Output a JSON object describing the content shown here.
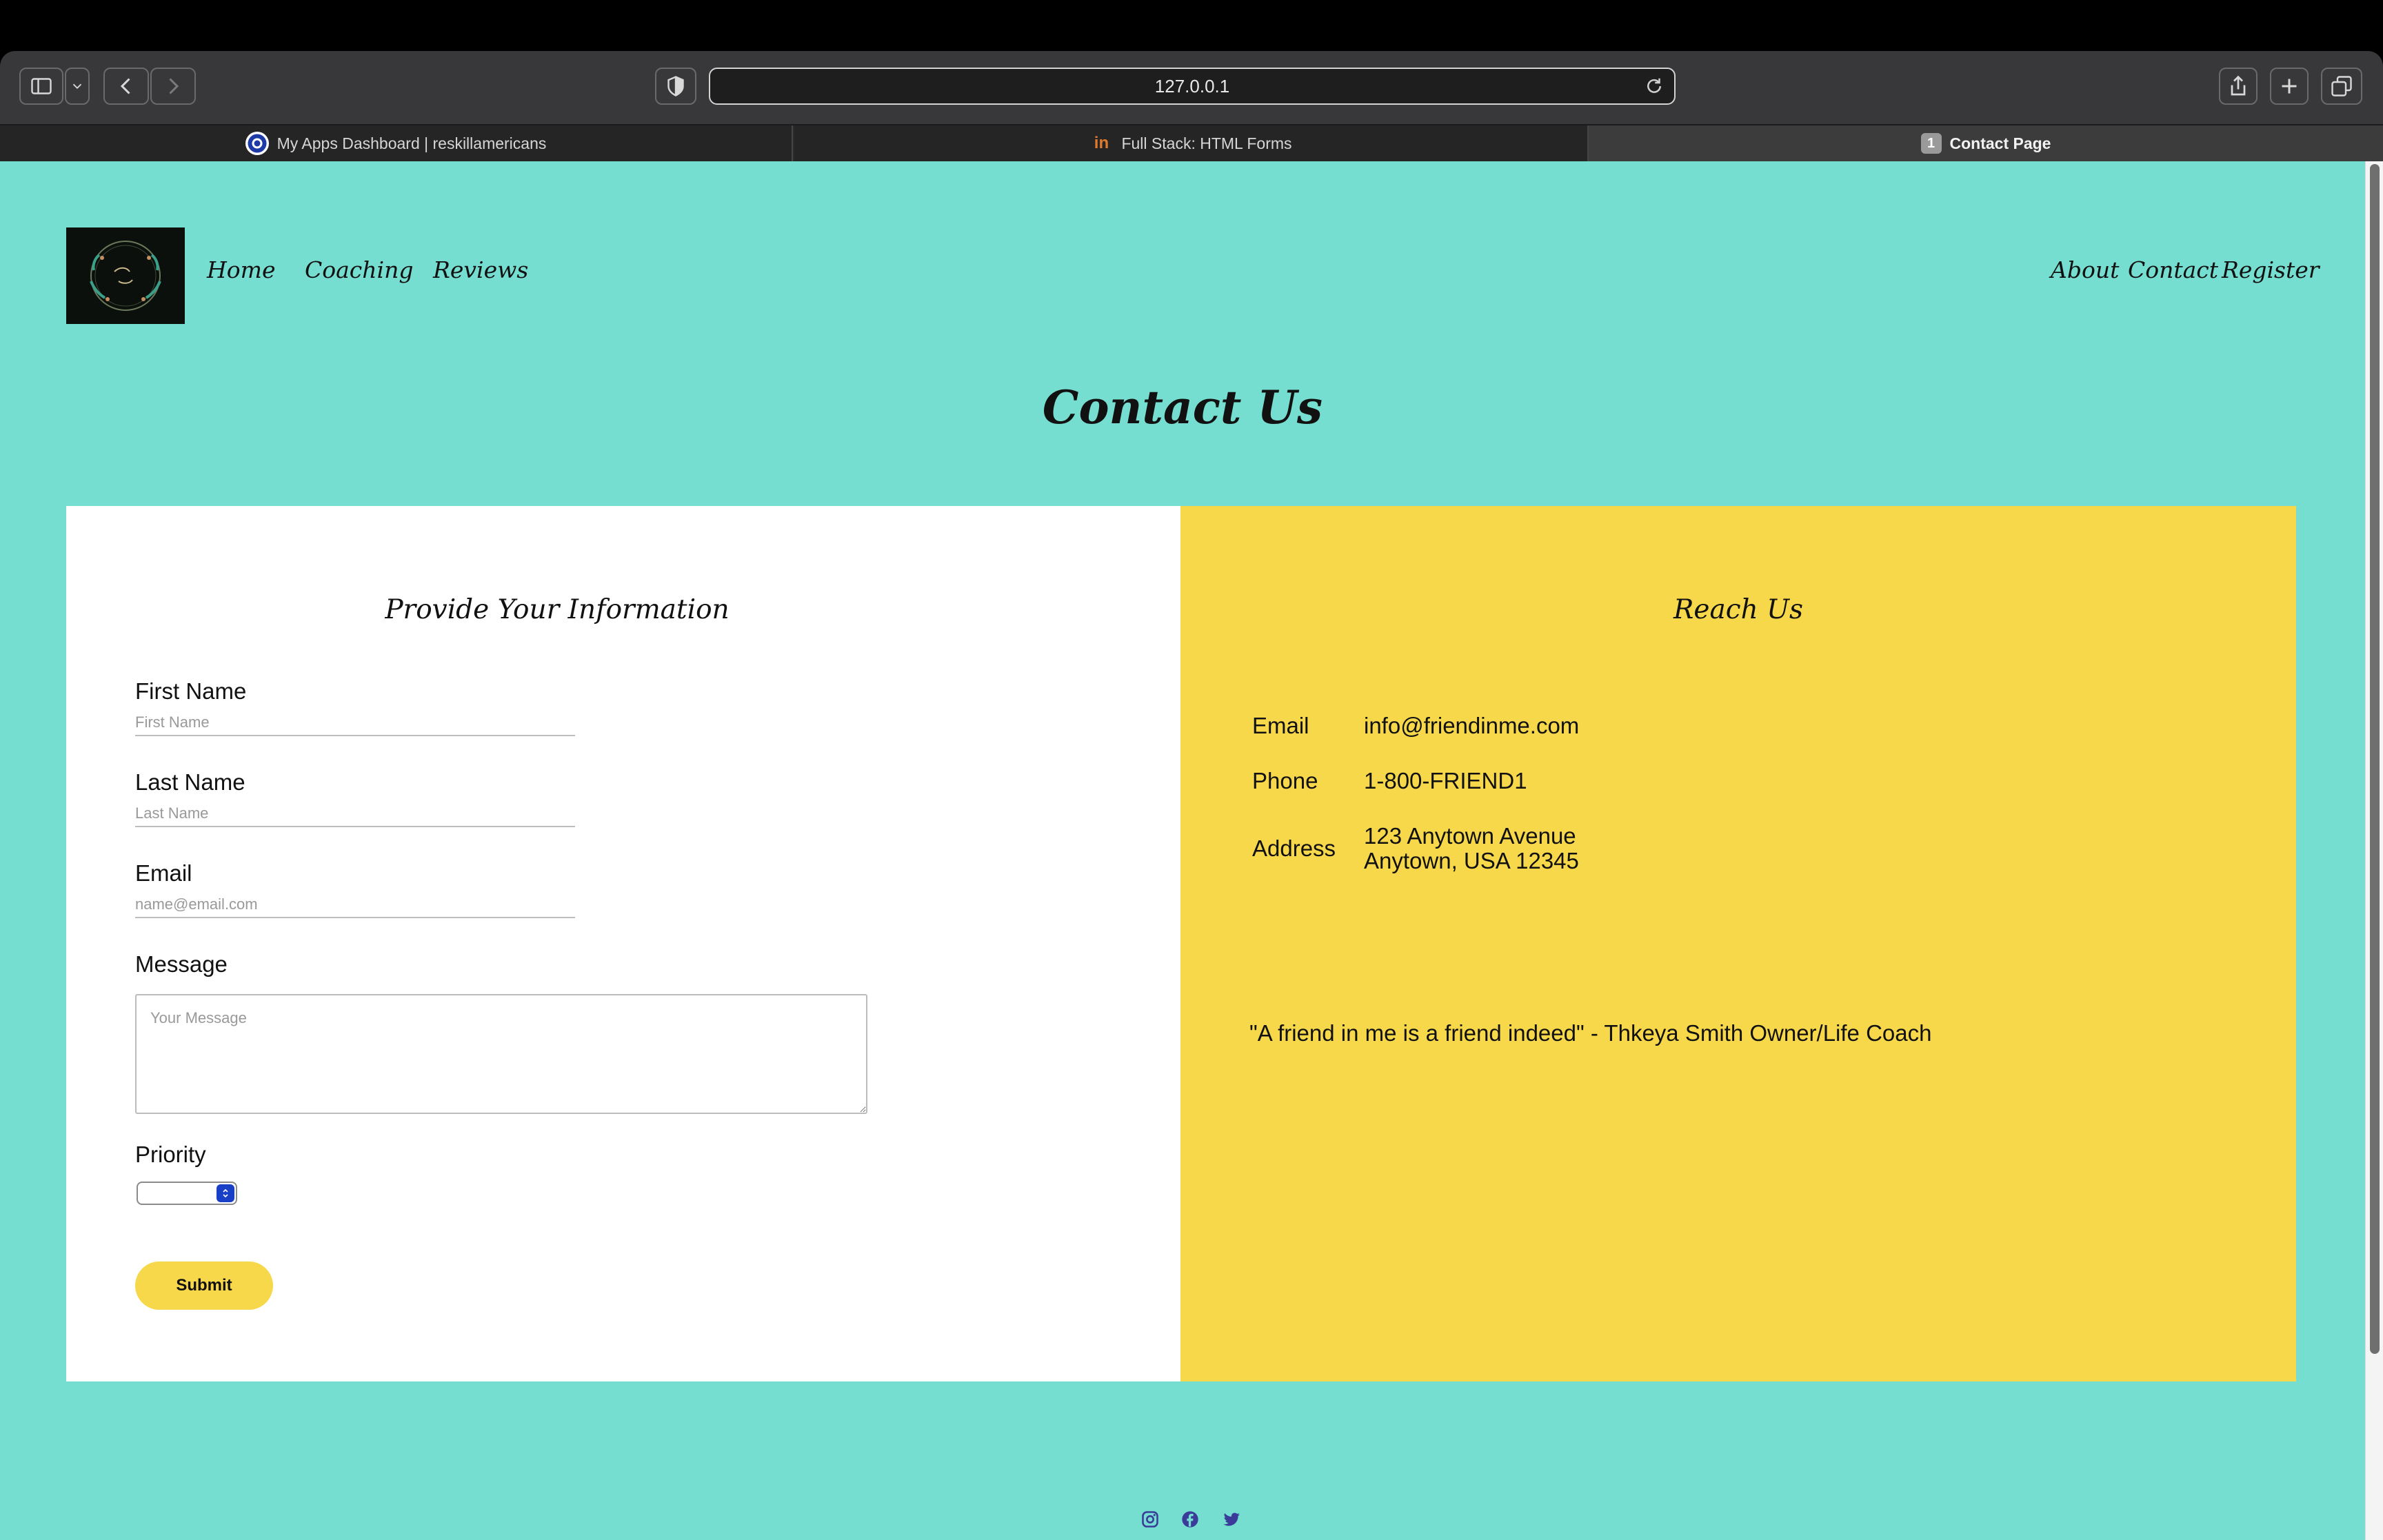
{
  "browser": {
    "url": "127.0.0.1",
    "tabs": [
      {
        "label": "My Apps Dashboard | reskillamericans",
        "favicon": "circle-logo-icon"
      },
      {
        "label": "Full Stack: HTML Forms",
        "favicon": "in-logo-icon"
      },
      {
        "label": "Contact Page",
        "favicon": "1",
        "active": true
      }
    ]
  },
  "nav": {
    "left": [
      "Home",
      "Coaching",
      "Reviews"
    ],
    "right": [
      "About",
      "Contact",
      "Register"
    ]
  },
  "page": {
    "title": "Contact Us"
  },
  "form": {
    "title": "Provide Your Information",
    "first_name": {
      "label": "First Name",
      "placeholder": "First Name",
      "value": ""
    },
    "last_name": {
      "label": "Last Name",
      "placeholder": "Last Name",
      "value": ""
    },
    "email": {
      "label": "Email",
      "placeholder": "name@email.com",
      "value": ""
    },
    "message": {
      "label": "Message",
      "placeholder": "Your Message",
      "value": ""
    },
    "priority": {
      "label": "Priority",
      "selected": ""
    },
    "submit_label": "Submit"
  },
  "reach": {
    "title": "Reach Us",
    "email_label": "Email",
    "email_value": "info@friendinme.com",
    "phone_label": "Phone",
    "phone_value": "1-800-FRIEND1",
    "address_label": "Address",
    "address_line1": "123 Anytown Avenue",
    "address_line2": "Anytown, USA 12345",
    "quote": "\"A friend in me is a friend indeed\" - Thkeya Smith Owner/Life Coach"
  },
  "footer": {
    "icons": [
      "instagram-icon",
      "facebook-icon",
      "twitter-icon"
    ]
  },
  "colors": {
    "page_bg": "#75ded0",
    "accent_yellow": "#f8d84b",
    "panel_white": "#ffffff"
  }
}
